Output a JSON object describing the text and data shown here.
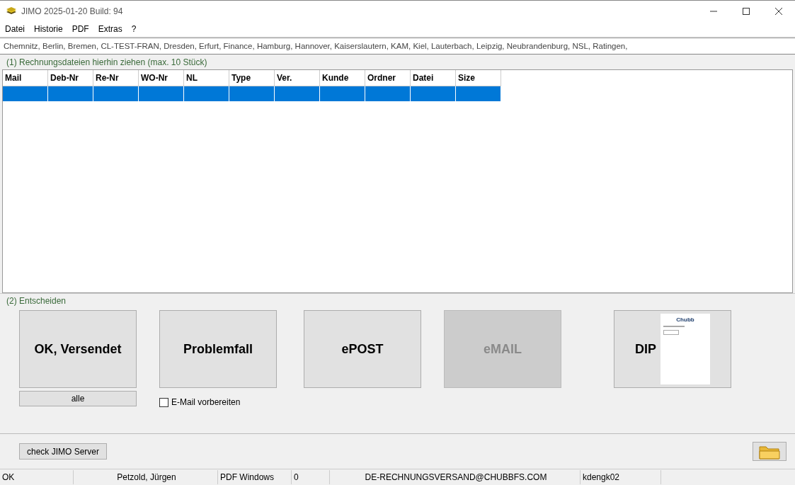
{
  "window": {
    "title": "JIMO 2025-01-20 Build: 94"
  },
  "menu": [
    "Datei",
    "Historie",
    "PDF",
    "Extras",
    "?"
  ],
  "branches": {
    "text": "Chemnitz, Berlin, Bremen, CL-TEST-FRAN, Dresden, Erfurt, Finance, Hamburg, Hannover, Kaiserslautern, KAM, Kiel, Lauterbach, Leipzig,",
    "tail_text": "Neubrandenburg, NSL, Ratingen,"
  },
  "drop_group": {
    "label": "(1) Rechnungsdateien hierhin ziehen (max. 10 Stück)"
  },
  "table": {
    "columns": [
      "Mail",
      "Deb-Nr",
      "Re-Nr",
      "WO-Nr",
      "NL",
      "Type",
      "Ver.",
      "Kunde",
      "Ordner",
      "Datei",
      "Size"
    ],
    "rows": [
      {
        "selected": true
      }
    ]
  },
  "decide_group": {
    "label": "(2) Entscheiden"
  },
  "actions": [
    {
      "label": "OK, Versendet",
      "disabled": false,
      "kind": "plain"
    },
    {
      "label": "Problemfall",
      "disabled": false,
      "kind": "plain"
    },
    {
      "label": "ePOST",
      "disabled": false,
      "kind": "plain"
    },
    {
      "label": "eMAIL",
      "disabled": true,
      "kind": "plain"
    },
    {
      "label": "DIP",
      "disabled": false,
      "kind": "preview",
      "preview_logo": "Chubb"
    }
  ],
  "all_button": "alle",
  "email_prepare": {
    "label": "E-Mail vorbereiten",
    "checked": false
  },
  "server_button": "check JIMO Server",
  "status_bar": [
    "OK",
    "Petzold, Jürgen",
    "PDF Windows",
    "0",
    "DE-RECHNUNGSVERSAND@CHUBBFS.COM",
    "kdengk02"
  ]
}
